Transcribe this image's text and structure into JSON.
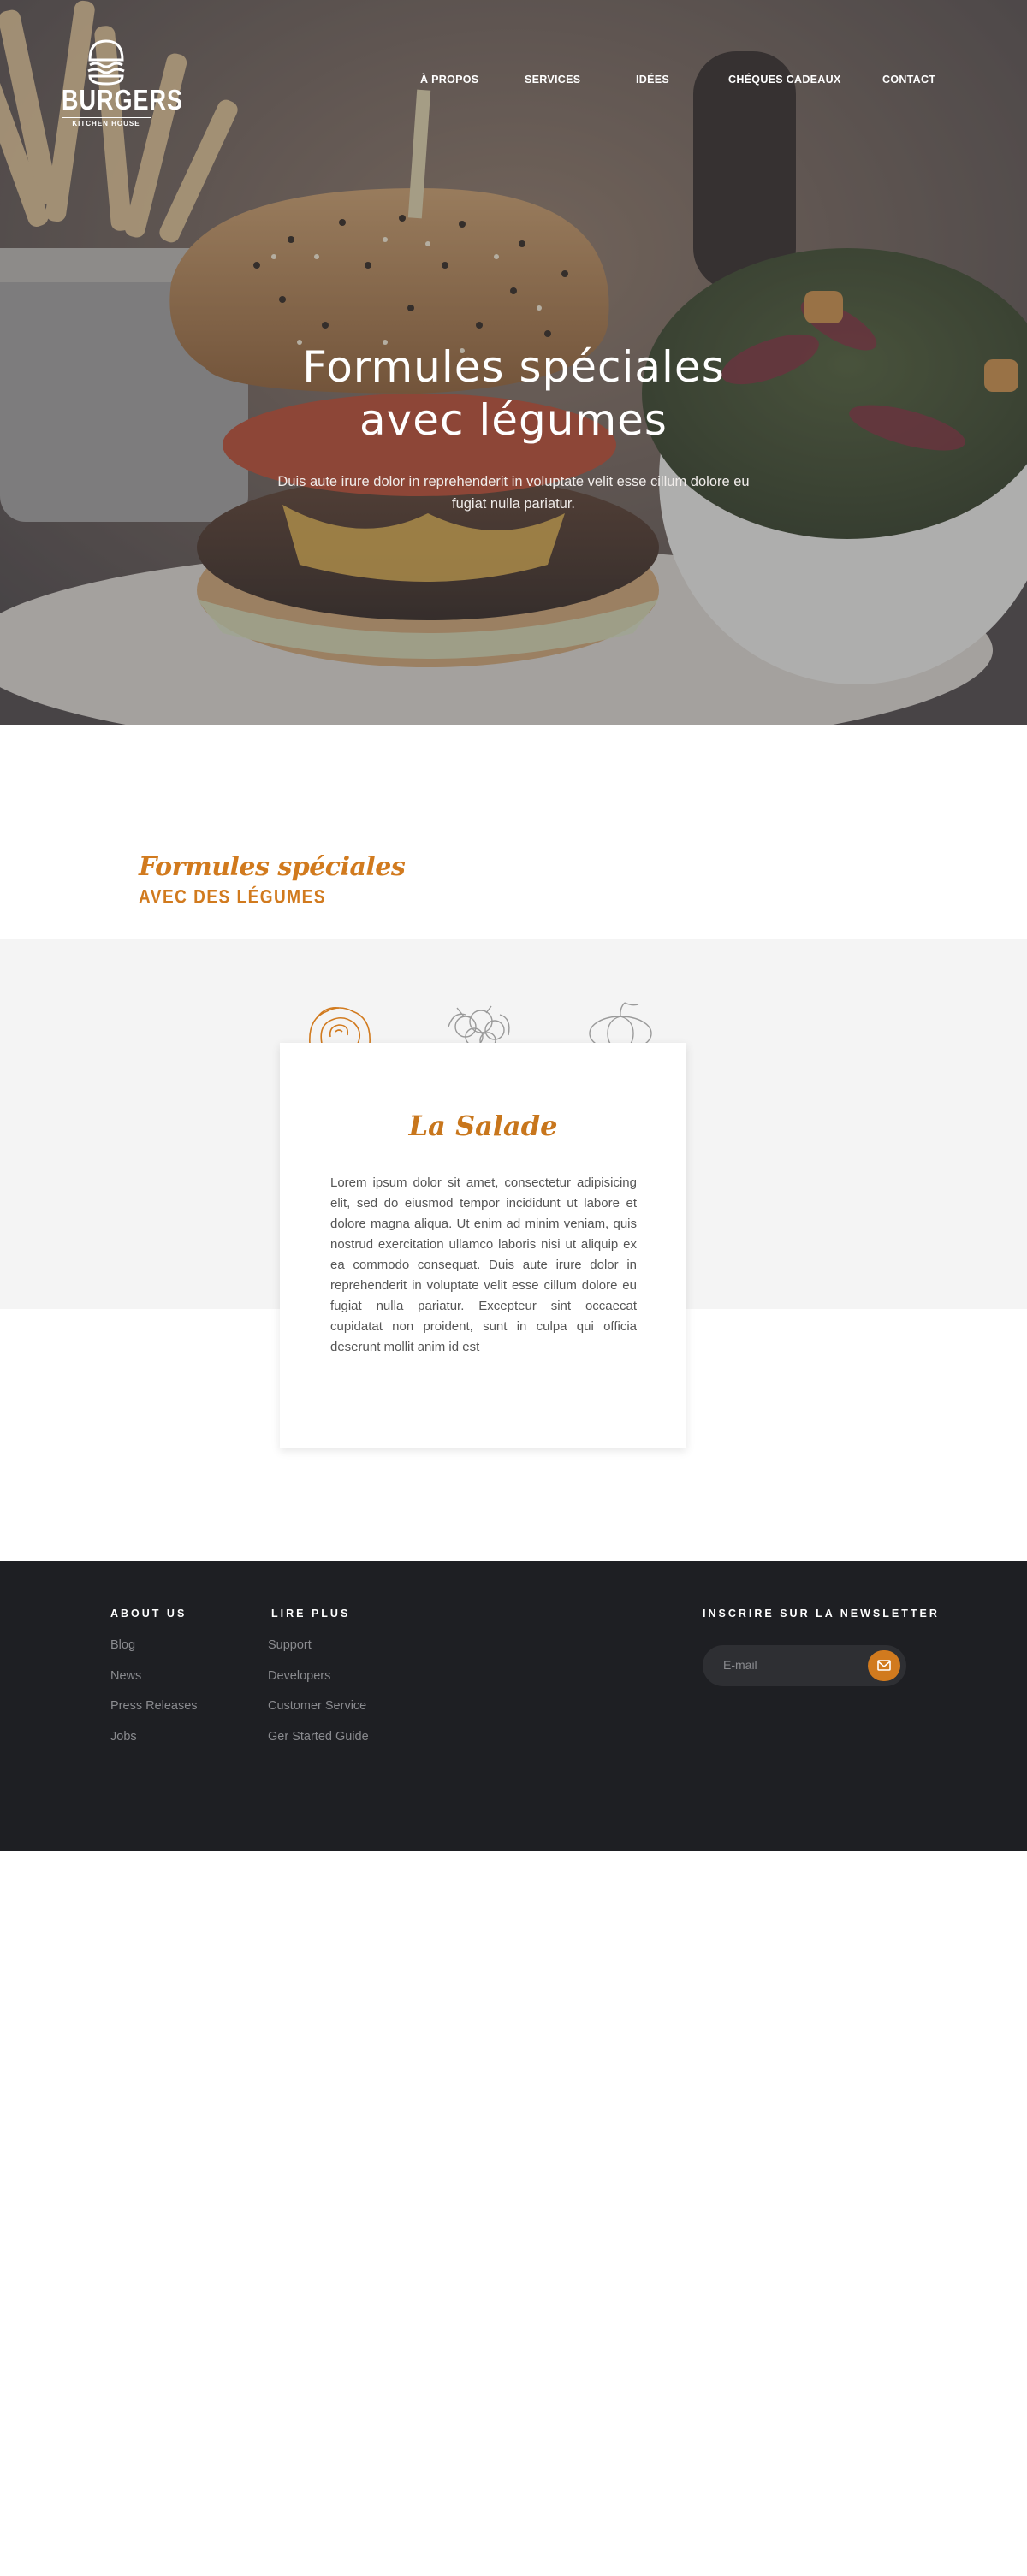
{
  "brand": {
    "name": "BURGERS",
    "tagline": "KITCHEN HOUSE"
  },
  "nav": {
    "items": [
      {
        "label": "À PROPOS"
      },
      {
        "label": "SERVICES"
      },
      {
        "label": "IDÉES"
      },
      {
        "label": "CHÉQUES CADEAUX"
      },
      {
        "label": "CONTACT"
      }
    ]
  },
  "hero": {
    "title_line1": "Formules spéciales",
    "title_line2": "avec légumes",
    "subtitle": "Duis aute irure dolor in reprehenderit in voluptate velit esse cillum dolore eu fugiat nulla pariatur."
  },
  "section": {
    "script_title": "Formules spéciales",
    "caps_title": "AVEC DES LÉGUMES",
    "icons": [
      "rose-icon",
      "cauliflower-icon",
      "pumpkin-icon"
    ]
  },
  "card": {
    "title": "La Salade",
    "text": "Lorem ipsum dolor sit amet, consectetur adipisicing elit, sed do eiusmod tempor incididunt ut labore et dolore magna aliqua. Ut enim ad minim veniam, quis nostrud exercitation ullamco laboris nisi ut aliquip ex ea commodo consequat. Duis aute irure dolor in reprehenderit in voluptate velit esse cillum dolore eu fugiat nulla pariatur. Excepteur sint occaecat cupidatat non proident, sunt in culpa qui officia deserunt mollit anim id est"
  },
  "footer": {
    "about": {
      "heading": "ABOUT US",
      "links": [
        "Blog",
        "News",
        "Press Releases",
        "Jobs"
      ]
    },
    "more": {
      "heading": "LIRE PLUS",
      "links": [
        "Support",
        "Developers",
        "Customer Service",
        "Ger Started Guide"
      ]
    },
    "newsletter": {
      "heading": "INSCRIRE SUR LA NEWSLETTER",
      "placeholder": "E-mail",
      "icon": "mail-icon"
    }
  },
  "colors": {
    "accent": "#d17a1e",
    "footer_bg": "#1e1f23",
    "band_bg": "#f4f4f4"
  }
}
